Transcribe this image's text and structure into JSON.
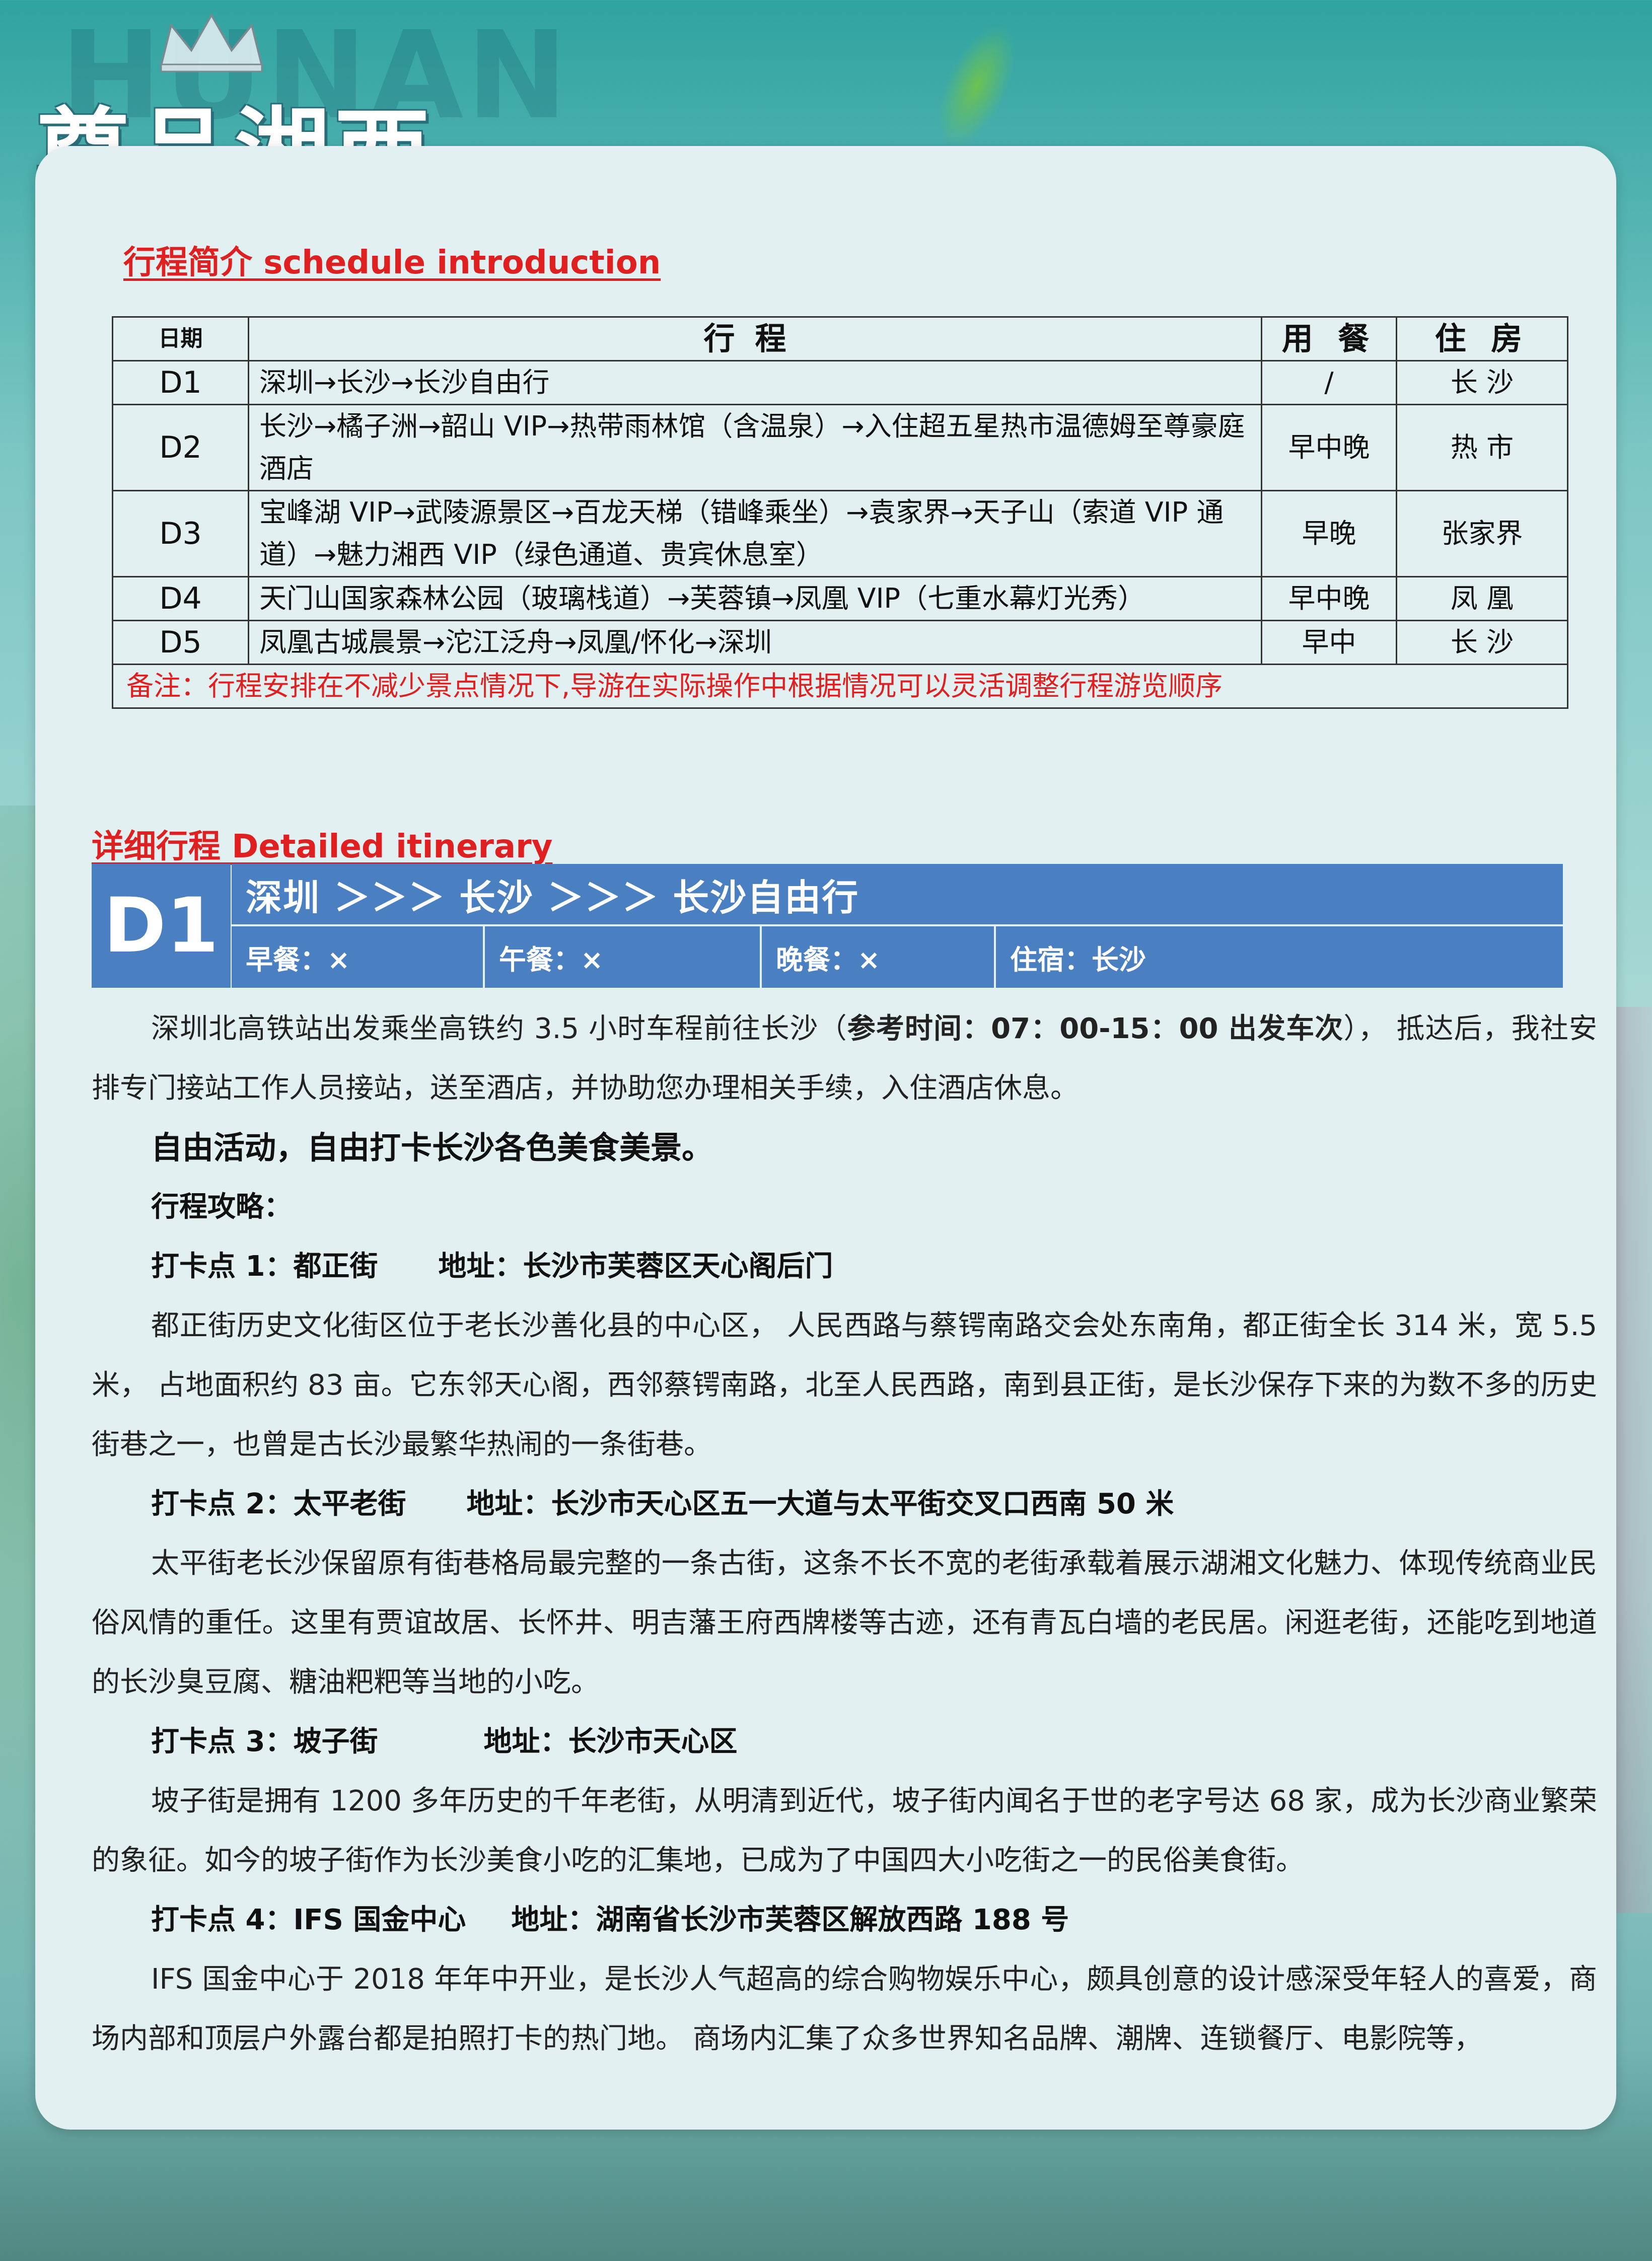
{
  "header": {
    "title": "尊品湘西",
    "watermark": "HUNAN"
  },
  "schedule": {
    "heading": "行程简介  schedule introduction",
    "columns": {
      "day": "日期",
      "route": "行程",
      "meal": "用 餐",
      "stay": "住 房"
    },
    "rows": [
      {
        "day": "D1",
        "route": "深圳→长沙→长沙自由行",
        "meal": "/",
        "stay": "长 沙"
      },
      {
        "day": "D2",
        "route": "长沙→橘子洲→韶山 VIP→热带雨林馆（含温泉）→入住超五星热市温德姆至尊豪庭酒店",
        "meal": "早中晚",
        "stay": "热 市"
      },
      {
        "day": "D3",
        "route": "宝峰湖 VIP→武陵源景区→百龙天梯（错峰乘坐）→袁家界→天子山（索道 VIP 通道）→魅力湘西 VIP（绿色通道、贵宾休息室）",
        "meal": "早晚",
        "stay": "张家界"
      },
      {
        "day": "D4",
        "route": "天门山国家森林公园（玻璃栈道）→芙蓉镇→凤凰 VIP（七重水幕灯光秀）",
        "meal": "早中晚",
        "stay": "凤 凰"
      },
      {
        "day": "D5",
        "route": "凤凰古城晨景→沱江泛舟→凤凰/怀化→深圳",
        "meal": "早中",
        "stay": "长 沙"
      }
    ],
    "note": "备注：行程安排在不减少景点情况下,导游在实际操作中根据情况可以灵活调整行程游览顺序"
  },
  "detail": {
    "heading": "详细行程  Detailed itinerary",
    "day_label": "D1",
    "route": "深圳 ＞＞＞ 长沙 ＞＞＞ 长沙自由行",
    "breakfast": "早餐：×",
    "lunch": "午餐：×",
    "dinner": "晚餐：×",
    "lodging": "住宿：长沙",
    "intro_a": "深圳北高铁站出发乘坐高铁约 3.5 小时车程前往长沙（",
    "intro_bold": "参考时间：07：00-15：00 出发车次",
    "intro_b": "）， 抵达后，我社安排专门接站工作人员接站，送至酒店，并协助您办理相关手续，入住酒店休息。",
    "free": "自由活动，自由打卡长沙各色美食美景。",
    "guide": "行程攻略：",
    "spots": [
      {
        "name": "打卡点 1：都正街",
        "address": "地址：长沙市芙蓉区天心阁后门",
        "desc": "都正街历史文化街区位于老长沙善化县的中心区， 人民西路与蔡锷南路交会处东南角，都正街全长 314 米，宽 5.5 米， 占地面积约 83 亩。它东邻天心阁，西邻蔡锷南路，北至人民西路，南到县正街，是长沙保存下来的为数不多的历史街巷之一，也曾是古长沙最繁华热闹的一条街巷。"
      },
      {
        "name": "打卡点 2：太平老街",
        "address": "地址：长沙市天心区五一大道与太平街交叉口西南 50 米",
        "desc": "太平街老长沙保留原有街巷格局最完整的一条古街，这条不长不宽的老街承载着展示湖湘文化魅力、体现传统商业民俗风情的重任。这里有贾谊故居、长怀井、明吉藩王府西牌楼等古迹，还有青瓦白墙的老民居。闲逛老街，还能吃到地道的长沙臭豆腐、糖油粑粑等当地的小吃。"
      },
      {
        "name": "打卡点 3：坡子街",
        "address": "地址：长沙市天心区",
        "desc": "坡子街是拥有 1200 多年历史的千年老街，从明清到近代，坡子街内闻名于世的老字号达 68 家，成为长沙商业繁荣的象征。如今的坡子街作为长沙美食小吃的汇集地，已成为了中国四大小吃街之一的民俗美食街。"
      },
      {
        "name": "打卡点 4：IFS 国金中心",
        "address": "地址：湖南省长沙市芙蓉区解放西路 188 号",
        "desc": "IFS 国金中心于 2018 年年中开业，是长沙人气超高的综合购物娱乐中心，颇具创意的设计感深受年轻人的喜爱，商场内部和顶层户外露台都是拍照打卡的热门地。 商场内汇集了众多世界知名品牌、潮牌、连锁餐厅、电影院等，"
      }
    ]
  }
}
